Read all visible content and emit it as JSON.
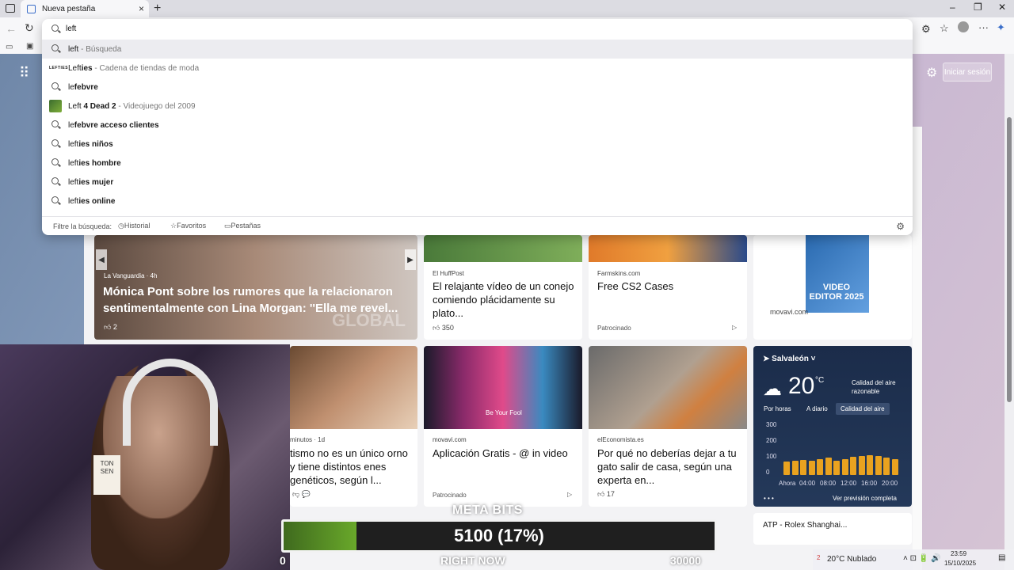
{
  "browser": {
    "tab_title": "Nueva pestaña",
    "new_tab": "+",
    "close_tab": "×",
    "address_value": "left",
    "window_controls": [
      "–",
      "❐",
      "✕"
    ]
  },
  "omnibox": {
    "suggestions": [
      {
        "bold": "",
        "normal": "left",
        "desc": " - Búsqueda",
        "icon": "search-icon"
      },
      {
        "bold": "",
        "normal": "Left",
        "suffix": "ies",
        "desc": " - Cadena de tiendas de moda",
        "icon": "lefties-logo"
      },
      {
        "normal": "le",
        "suffix": "febvre",
        "desc": "",
        "icon": "search-icon"
      },
      {
        "normal": "Left",
        "suffix": " 4 Dead 2",
        "desc": " - Videojuego del 2009",
        "icon": "l4d-logo"
      },
      {
        "normal": "le",
        "suffix": "febvre acceso clientes",
        "desc": "",
        "icon": "search-icon"
      },
      {
        "normal": "left",
        "suffix": "ies niños",
        "desc": "",
        "icon": "search-icon"
      },
      {
        "normal": "left",
        "suffix": "ies hombre",
        "desc": "",
        "icon": "search-icon"
      },
      {
        "normal": "left",
        "suffix": "ies mujer",
        "desc": "",
        "icon": "search-icon"
      },
      {
        "normal": "left",
        "suffix": "ies online",
        "desc": "",
        "icon": "search-icon"
      }
    ],
    "lefties_logo_text": "LEFTIES",
    "filter_label": "Filtre la búsqueda:",
    "filter_history": "Historial",
    "filter_favorites": "Favoritos",
    "filter_tabs": "Pestañas"
  },
  "newtab": {
    "signin": "Iniciar sesión",
    "hero": {
      "source": "La Vanguardia · 4h",
      "headline": "Mónica Pont sobre los rumores que la relacionaron sentimentalmente con Lina Morgan: ''Ella me revel...",
      "likes": "2",
      "watermark": "GLOBAL"
    },
    "cards": [
      {
        "source": "El HuffPost",
        "headline": "El relajante vídeo de un conejo comiendo plácidamente su plato...",
        "likes": "350"
      },
      {
        "source": "Farmskins.com",
        "headline": "Free CS2 Cases",
        "sponsored": "Patrocinado"
      },
      {
        "source": "movavi.com",
        "ad_title": "VIDEO EDITOR 2025"
      },
      {
        "source": "minutos · 1d",
        "headline": "tismo no es un único orno y tiene distintos enes genéticos, según l..."
      },
      {
        "source": "movavi.com",
        "headline": "Aplicación Gratis - @ in video",
        "sponsored": "Patrocinado",
        "image_caption": "Be Your Fool"
      },
      {
        "source": "elEconomista.es",
        "headline": "Por qué no deberías dejar a tu gato salir de casa, según una experta en...",
        "likes": "17"
      }
    ],
    "weather": {
      "location": "Salvaleón",
      "temp": "20",
      "unit": "°C",
      "air_quality": "Calidad del aire razonable",
      "tabs": [
        "Por horas",
        "A diario",
        "Calidad del aire"
      ],
      "yticks": [
        "300",
        "200",
        "100",
        "0"
      ],
      "xticks": [
        "Ahora",
        "04:00",
        "08:00",
        "12:00",
        "16:00",
        "20:00"
      ],
      "bars": [
        28,
        30,
        32,
        30,
        34,
        36,
        30,
        34,
        38,
        40,
        42,
        40,
        36,
        34
      ],
      "link": "Ver previsión completa"
    },
    "atp": "ATP - Rolex Shanghai..."
  },
  "overlay": {
    "meta_title": "META BITS",
    "meta_value": "5100 (17%)",
    "meta_progress": 0.17,
    "start": "0",
    "right_now": "RIGHT NOW",
    "goal": "30000",
    "webcam_sign": "TON SEN"
  },
  "taskbar": {
    "weather": "20°C  Nublado",
    "time": "23:59",
    "date": "15/10/2025",
    "badge": "2"
  },
  "colors": {
    "accent": "#3b6ec9",
    "weather_bg": "#1b2c4a",
    "bar": "#e9a21f",
    "progress": "#69a82a"
  }
}
